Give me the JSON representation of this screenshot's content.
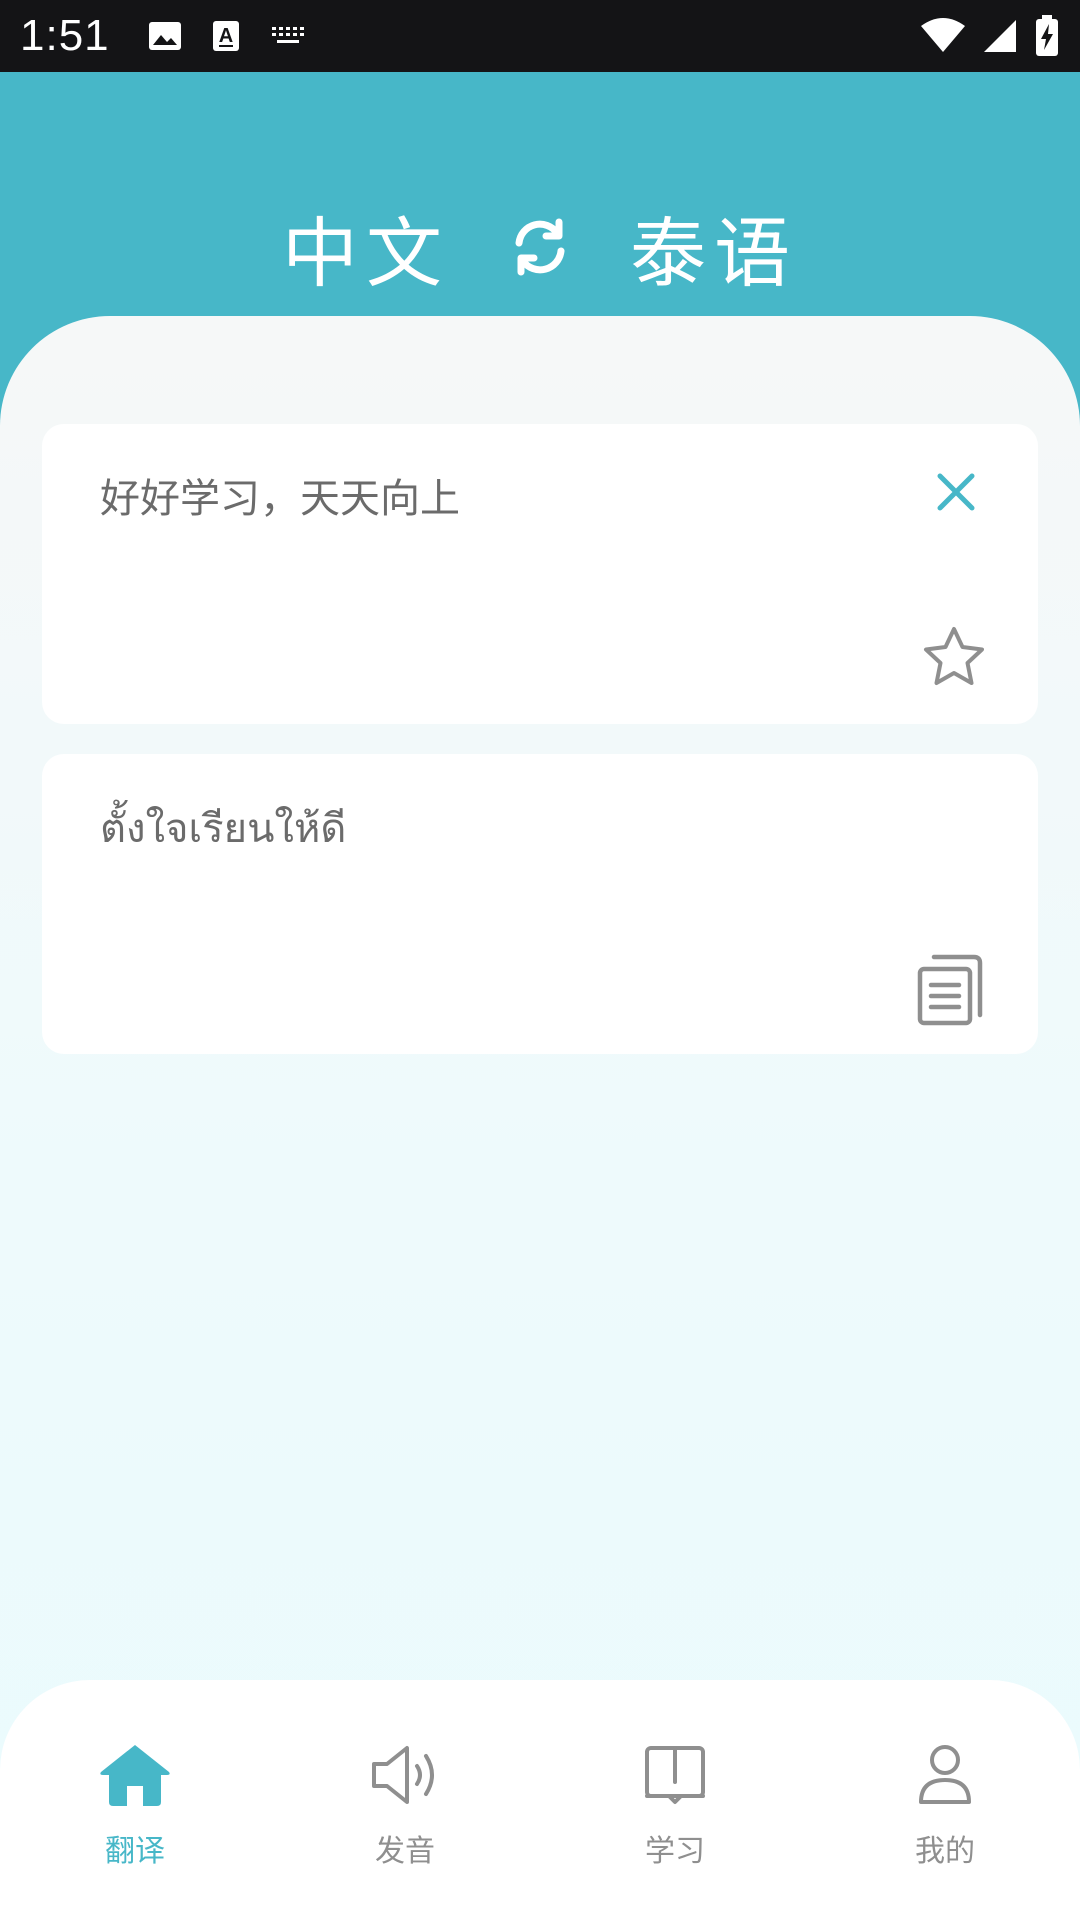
{
  "status_bar": {
    "time": "1:51",
    "left_icons": [
      "image-icon",
      "text-a-icon",
      "keyboard-icon"
    ],
    "right_icons": [
      "wifi-icon",
      "signal-icon",
      "battery-charging-icon"
    ]
  },
  "header": {
    "source_language": "中文",
    "target_language": "泰语",
    "swap_icon": "refresh-icon"
  },
  "input_card": {
    "text": "好好学习，天天向上",
    "clear_icon": "close-icon",
    "favorite_icon": "star-outline-icon"
  },
  "output_card": {
    "text": "ตั้งใจเรียนให้ดี",
    "copy_icon": "copy-icon"
  },
  "bottom_nav": {
    "items": [
      {
        "label": "翻译",
        "icon": "home-icon",
        "active": true
      },
      {
        "label": "发音",
        "icon": "speaker-icon",
        "active": false
      },
      {
        "label": "学习",
        "icon": "book-icon",
        "active": false
      },
      {
        "label": "我的",
        "icon": "user-icon",
        "active": false
      }
    ]
  },
  "colors": {
    "accent": "#47b7c8",
    "status_bar": "#141416",
    "text_gray": "#6b6b6b",
    "icon_gray": "#8f8f8f"
  }
}
